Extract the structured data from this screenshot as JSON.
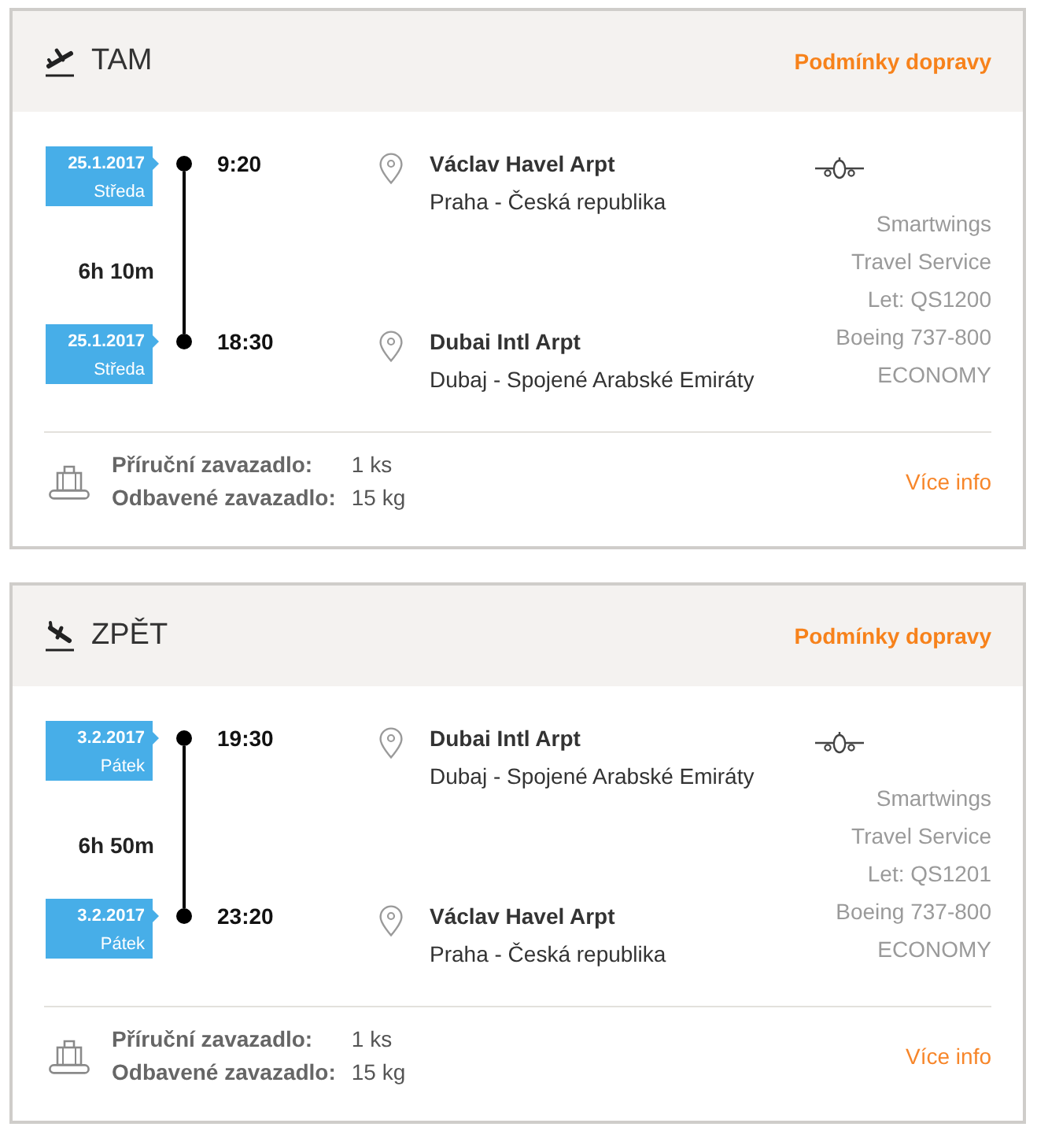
{
  "trips": [
    {
      "kind": "outbound",
      "title": "TAM",
      "conditions_link": "Podmínky dopravy",
      "stops": [
        {
          "date": "25.1.2017",
          "day": "Středa",
          "time": "9:20",
          "airport": "Václav Havel Arpt",
          "place": "Praha - Česká republika"
        },
        {
          "date": "25.1.2017",
          "day": "Středa",
          "time": "18:30",
          "airport": "Dubai Intl Arpt",
          "place": "Dubaj - Spojené Arabské Emiráty"
        }
      ],
      "duration": "6h 10m",
      "carrier": {
        "airline": "Smartwings",
        "operator": "Travel Service",
        "flight": "Let: QS1200",
        "aircraft": "Boeing 737-800",
        "cabin_class": "ECONOMY"
      },
      "baggage": [
        {
          "label": "Příruční zavazadlo:",
          "value": "1 ks"
        },
        {
          "label": "Odbavené zavazadlo:",
          "value": "15 kg"
        }
      ],
      "more_info_link": "Více info"
    },
    {
      "kind": "inbound",
      "title": "ZPĚT",
      "conditions_link": "Podmínky dopravy",
      "stops": [
        {
          "date": "3.2.2017",
          "day": "Pátek",
          "time": "19:30",
          "airport": "Dubai Intl Arpt",
          "place": "Dubaj - Spojené Arabské Emiráty"
        },
        {
          "date": "3.2.2017",
          "day": "Pátek",
          "time": "23:20",
          "airport": "Václav Havel Arpt",
          "place": "Praha - Česká republika"
        }
      ],
      "duration": "6h 50m",
      "carrier": {
        "airline": "Smartwings",
        "operator": "Travel Service",
        "flight": "Let: QS1201",
        "aircraft": "Boeing 737-800",
        "cabin_class": "ECONOMY"
      },
      "baggage": [
        {
          "label": "Příruční zavazadlo:",
          "value": "1 ks"
        },
        {
          "label": "Odbavené zavazadlo:",
          "value": "15 kg"
        }
      ],
      "more_info_link": "Více info"
    }
  ]
}
